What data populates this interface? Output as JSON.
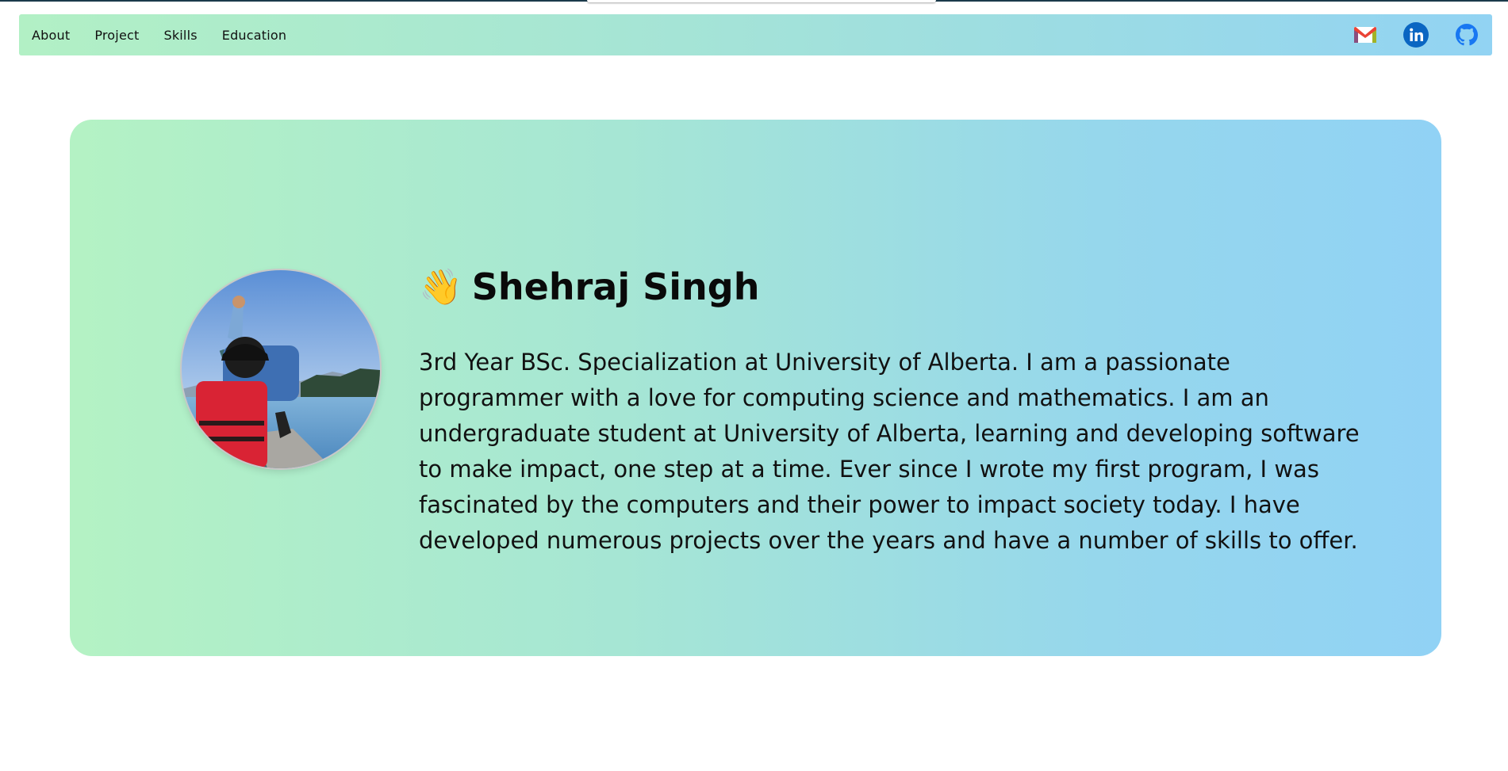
{
  "nav": {
    "links": [
      "About",
      "Project",
      "Skills",
      "Education"
    ],
    "icons": [
      {
        "name": "gmail-icon",
        "color": "#ea4335"
      },
      {
        "name": "linkedin-icon",
        "color": "#0a66c2"
      },
      {
        "name": "github-icon",
        "color": "#1877f2"
      }
    ]
  },
  "hero": {
    "wave_emoji": "👋",
    "name": "Shehraj Singh",
    "bio": "3rd Year BSc. Specialization at University of Alberta. I am a passionate programmer with a love for computing science and mathematics. I am an undergraduate student at University of Alberta, learning and developing software to make impact, one step at a time. Ever since I wrote my first program, I was fascinated by the computers and their power to impact society today. I have developed numerous projects over the years and have a number of skills to offer."
  },
  "colors": {
    "gradient_start": "#b4f2c4",
    "gradient_end": "#91d2f5"
  }
}
